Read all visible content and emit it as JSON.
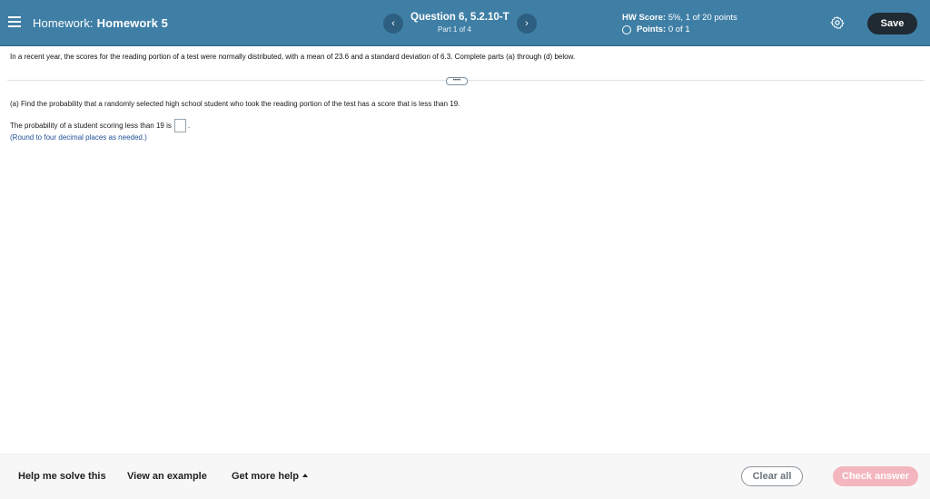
{
  "header": {
    "homework_prefix": "Homework:",
    "homework_name": "Homework 5",
    "question_title": "Question 6, 5.2.10-T",
    "question_part": "Part 1 of 4",
    "prev_label": "‹",
    "next_label": "›",
    "score_label": "HW Score:",
    "score_value": "5%, 1 of 20 points",
    "points_label": "Points:",
    "points_value": "0 of 1",
    "save_label": "Save"
  },
  "question": {
    "intro": "In a recent year, the scores for the reading portion of a test were normally distributed, with a mean of 23.6 and a standard deviation of 6.3. Complete parts (a) through (d) below.",
    "expand_label": "••••",
    "part_a": "(a) Find the probability that a randomly selected high school student who took the reading portion of the test has a score that is less than 19.",
    "answer_prefix": "The probability of a student scoring less than 19 is",
    "answer_value": "",
    "answer_suffix": ".",
    "round_note": "(Round to four decimal places as needed.)"
  },
  "footer": {
    "help_label": "Help me solve this",
    "example_label": "View an example",
    "more_help_label": "Get more help",
    "clear_label": "Clear all",
    "check_label": "Check answer"
  },
  "colors": {
    "header_bg": "#3f7fa6",
    "save_bg": "#1f2a33",
    "check_bg_disabled": "#f4b6be",
    "note_blue": "#1f4f95"
  },
  "icons": [
    "menu-icon",
    "chevron-left-icon",
    "chevron-right-icon",
    "points-circle-icon",
    "gear-icon",
    "caret-up-icon"
  ]
}
